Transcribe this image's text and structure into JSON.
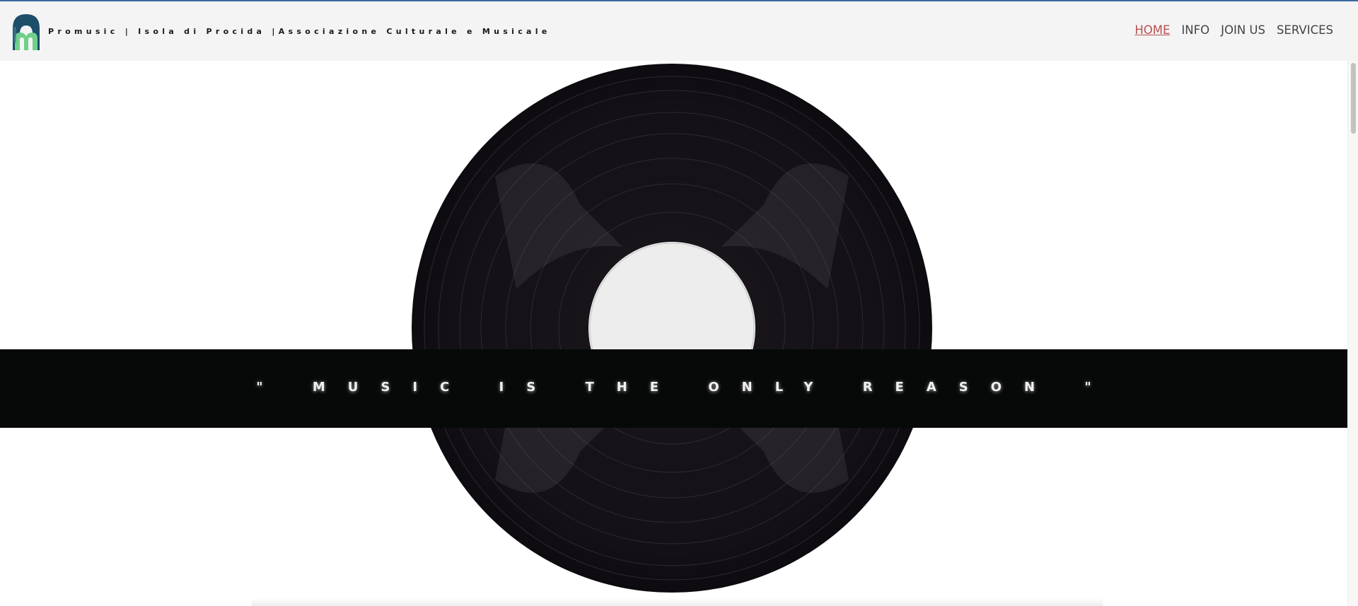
{
  "header": {
    "site_title": "Promusic | Isola di Procida |Associazione Culturale e Musicale"
  },
  "nav": {
    "items": [
      "HOME",
      "INFO",
      "JOIN US",
      "SERVICES"
    ],
    "active_index": 0,
    "active_color": "#b9504f"
  },
  "hero": {
    "quote": "\" MUSIC IS THE ONLY REASON \"",
    "record_color": "#141116",
    "label_color": "#eeeeee",
    "banner_color": "#070908"
  },
  "icons": {
    "logo": "promusic-logo-icon"
  }
}
